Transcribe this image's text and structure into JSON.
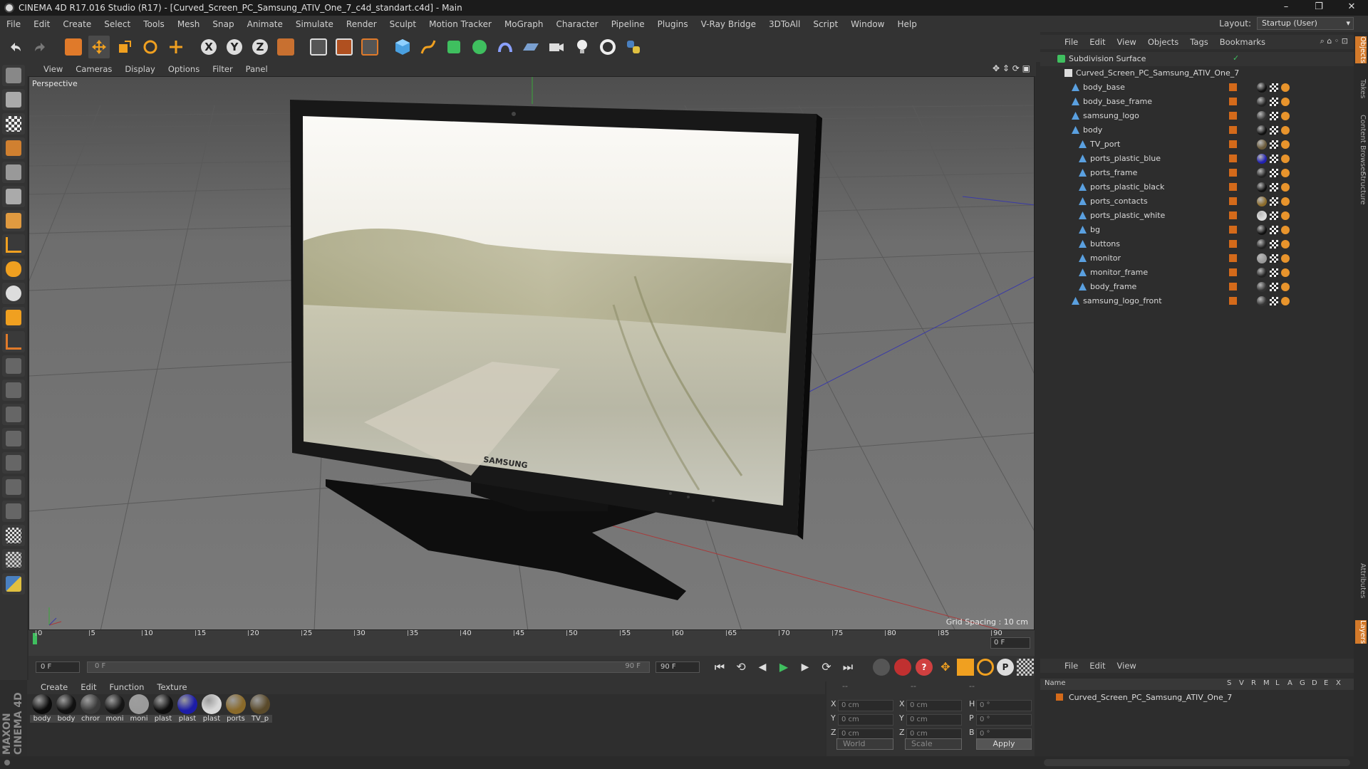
{
  "window": {
    "title": "CINEMA 4D R17.016 Studio (R17) - [Curved_Screen_PC_Samsung_ATIV_One_7_c4d_standart.c4d] - Main",
    "controls": [
      "–",
      "❐",
      "✕"
    ]
  },
  "menubar": {
    "items": [
      "File",
      "Edit",
      "Create",
      "Select",
      "Tools",
      "Mesh",
      "Snap",
      "Animate",
      "Simulate",
      "Render",
      "Sculpt",
      "Motion Tracker",
      "MoGraph",
      "Character",
      "Pipeline",
      "Plugins",
      "V-Ray Bridge",
      "3DToAll",
      "Script",
      "Window",
      "Help"
    ],
    "layout_label": "Layout:",
    "layout_value": "Startup (User)"
  },
  "viewport": {
    "menu": [
      "View",
      "Cameras",
      "Display",
      "Options",
      "Filter",
      "Panel"
    ],
    "label": "Perspective",
    "grid_spacing": "Grid Spacing : 10 cm",
    "brand_text": "SAMSUNG"
  },
  "timeline": {
    "ticks": [
      "0",
      "5",
      "10",
      "15",
      "20",
      "25",
      "30",
      "35",
      "40",
      "45",
      "50",
      "55",
      "60",
      "65",
      "70",
      "75",
      "80",
      "85",
      "90"
    ],
    "current_frame": "0 F",
    "start_field": "0 F",
    "range_start": "0 F",
    "range_end": "90 F",
    "end_field": "90 F"
  },
  "material_manager": {
    "menu": [
      "Create",
      "Edit",
      "Function",
      "Texture"
    ],
    "materials": [
      {
        "label": "body",
        "color": "#0b0b0b"
      },
      {
        "label": "body",
        "color": "#111111"
      },
      {
        "label": "chror",
        "color": "#3a3a3a"
      },
      {
        "label": "moni",
        "color": "#151515"
      },
      {
        "label": "moni",
        "color": "#9a9a9a"
      },
      {
        "label": "plast",
        "color": "#0e0e0e"
      },
      {
        "label": "plast",
        "color": "#1c1ca8"
      },
      {
        "label": "plast",
        "color": "#d8d8d8"
      },
      {
        "label": "ports",
        "color": "#8a6a2a"
      },
      {
        "label": "TV_p",
        "color": "#5a4a2a"
      }
    ]
  },
  "coords": {
    "header_left": "--",
    "header_mid": "--",
    "header_right": "--",
    "rows": [
      {
        "a": "X",
        "av": "0 cm",
        "b": "X",
        "bv": "0 cm",
        "c": "H",
        "cv": "0 °"
      },
      {
        "a": "Y",
        "av": "0 cm",
        "b": "Y",
        "bv": "0 cm",
        "c": "P",
        "cv": "0 °"
      },
      {
        "a": "Z",
        "av": "0 cm",
        "b": "Z",
        "bv": "0 cm",
        "c": "B",
        "cv": "0 °"
      }
    ],
    "world": "World",
    "scale": "Scale",
    "apply": "Apply"
  },
  "object_manager": {
    "menu": [
      "File",
      "Edit",
      "View",
      "Objects",
      "Tags",
      "Bookmarks"
    ],
    "objects": [
      {
        "name": "Subdivision Surface",
        "indent": 0,
        "tagball": ""
      },
      {
        "name": "Curved_Screen_PC_Samsung_ATIV_One_7",
        "indent": 1,
        "tagball": ""
      },
      {
        "name": "body_base",
        "indent": 2,
        "tagball": "#111"
      },
      {
        "name": "body_base_frame",
        "indent": 2,
        "tagball": "#222"
      },
      {
        "name": "samsung_logo",
        "indent": 2,
        "tagball": "#333"
      },
      {
        "name": "body",
        "indent": 2,
        "tagball": "#111"
      },
      {
        "name": "TV_port",
        "indent": 3,
        "tagball": "#6a5a3a"
      },
      {
        "name": "ports_plastic_blue",
        "indent": 3,
        "tagball": "#2020b0"
      },
      {
        "name": "ports_frame",
        "indent": 3,
        "tagball": "#222"
      },
      {
        "name": "ports_plastic_black",
        "indent": 3,
        "tagball": "#111"
      },
      {
        "name": "ports_contacts",
        "indent": 3,
        "tagball": "#8a6a2a"
      },
      {
        "name": "ports_plastic_white",
        "indent": 3,
        "tagball": "#ddd"
      },
      {
        "name": "bg",
        "indent": 3,
        "tagball": "#111"
      },
      {
        "name": "buttons",
        "indent": 3,
        "tagball": "#222"
      },
      {
        "name": "monitor",
        "indent": 3,
        "tagball": "#999"
      },
      {
        "name": "monitor_frame",
        "indent": 3,
        "tagball": "#222"
      },
      {
        "name": "body_frame",
        "indent": 3,
        "tagball": "#333"
      },
      {
        "name": "samsung_logo_front",
        "indent": 2,
        "tagball": "#333"
      }
    ]
  },
  "attributes": {
    "menu": [
      "File",
      "Edit",
      "View"
    ],
    "columns": [
      "Name",
      "S",
      "V",
      "R",
      "M",
      "L",
      "A",
      "G",
      "D",
      "E",
      "X"
    ],
    "row_name": "Curved_Screen_PC_Samsung_ATIV_One_7"
  },
  "sidebar_tabs": [
    "Objects",
    "Takes",
    "Content Browser",
    "Structure",
    "Attributes",
    "Layers"
  ]
}
